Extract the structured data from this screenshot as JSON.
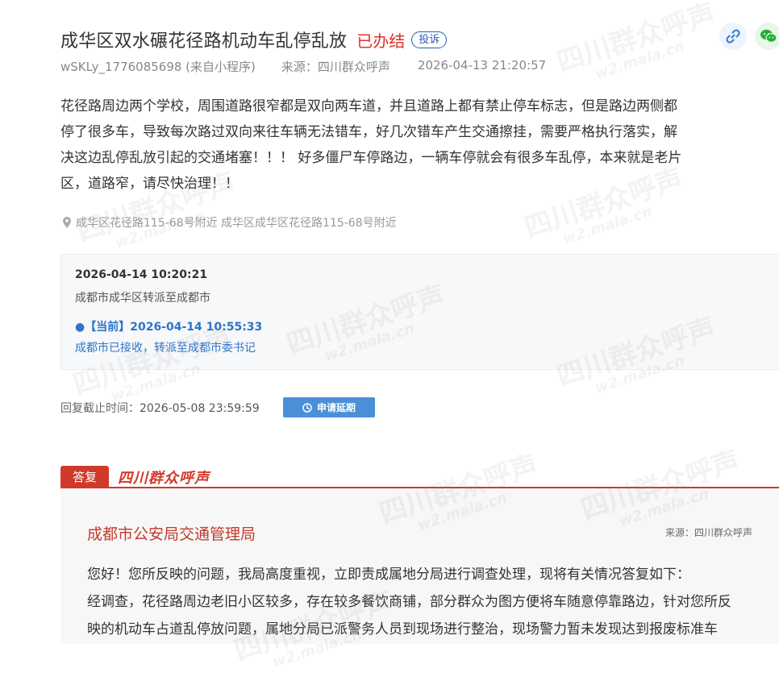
{
  "complaint": {
    "title": "成华区双水碾花径路机动车乱停乱放",
    "status": "已办结",
    "type_badge": "投诉",
    "user": "wSKLy_1776085698 (来自小程序)",
    "source": "来源：四川群众呼声",
    "time": "2026-04-13 21:20:57",
    "body_lines": [
      "花径路周边两个学校，周围道路很窄都是双向两车道，并且道路上都有禁止停车标志，但是路边两侧都",
      "停了很多车，导致每次路过双向来往车辆无法错车，好几次错车产生交通擦挂，需要严格执行落实，解",
      "决这边乱停乱放引起的交通堵塞！！！ 好多僵尸车停路边，一辆车停就会有很多车乱停，本来就是老片",
      "区，道路窄，请尽快治理！！"
    ],
    "location": "成华区花径路115-68号附近 成华区成华区花径路115-68号附近"
  },
  "progress": [
    {
      "date": "2026-04-14 10:20:21",
      "text": "成都市成华区转派至成都市"
    },
    {
      "date": "●【当前】2026-04-14 10:55:33",
      "text": "成都市已接收，转派至成都市委书记"
    }
  ],
  "deadline": {
    "label": "回复截止时间：",
    "value": "2026-05-08 23:59:59",
    "extend_button": "申请延期"
  },
  "reply": {
    "tag": "答复",
    "logo": "四川群众呼声",
    "department": "成都市公安局交通管理局",
    "source": "来源：四川群众呼声",
    "lines": [
      "您好！您所反映的问题，我局高度重视，立即责成属地分局进行调查处理，现将有关情况答复如下：",
      "经调查，花径路周边老旧小区较多，存在较多餐饮商铺，部分群众为图方便将车随意停靠路边，针对您所反",
      "映的机动车占道乱停放问题，属地分局已派警务人员到现场进行整治，现场警力暂未发现达到报废标准车"
    ]
  },
  "watermark": {
    "main": "四川群众呼声",
    "sub": "w2.mala.cn"
  },
  "colors": {
    "status_red": "#e0302a",
    "badge_blue": "#2a5db0",
    "current_blue": "#2c75c9",
    "button_blue": "#4a90d9",
    "reply_red": "#d03a2b"
  },
  "icons": {
    "share_link": "link-icon",
    "share_wechat": "wechat-icon",
    "location": "location-pin-icon",
    "extend": "clock-icon"
  }
}
